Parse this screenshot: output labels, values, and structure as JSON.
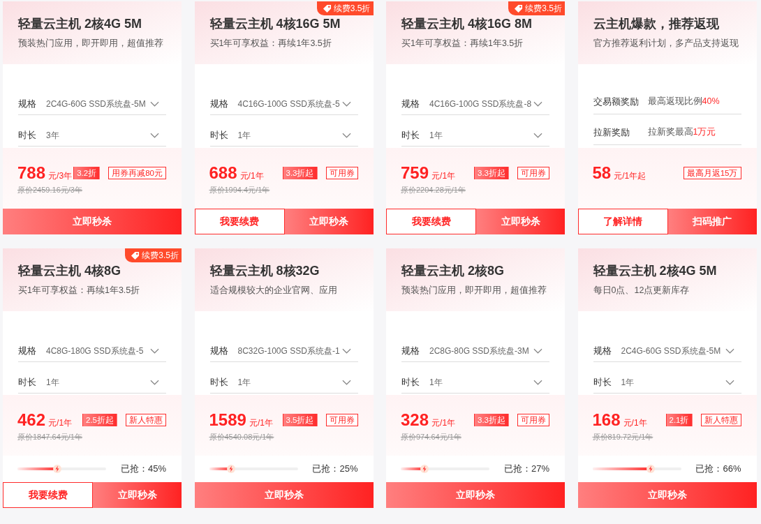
{
  "cards": [
    {
      "title": "轻量云主机 2核4G 5M",
      "subtitle": "预装热门应用，即开即用，超值推荐",
      "fields": [
        {
          "label": "规格",
          "value": "2C4G-60G SSD系统盘-5M"
        },
        {
          "label": "时长",
          "value": "3年"
        }
      ],
      "price": "788",
      "unit": "元/3年",
      "tags": [
        {
          "text": "3.2折",
          "kind": "filled"
        },
        {
          "text": "用券再减80元",
          "kind": "outline"
        }
      ],
      "original": "原价2459.16元/3年",
      "buttons": [
        {
          "label": "立即秒杀",
          "kind": "solid"
        }
      ]
    },
    {
      "title": "轻量云主机 4核16G 5M",
      "subtitle": "买1年可享权益：再续1年3.5折",
      "badge": "续费3.5折",
      "fields": [
        {
          "label": "规格",
          "value": "4C16G-100G SSD系统盘-5"
        },
        {
          "label": "时长",
          "value": "1年"
        }
      ],
      "price": "688",
      "unit": "元/1年",
      "tags": [
        {
          "text": "3.3折起",
          "kind": "filled"
        },
        {
          "text": "可用券",
          "kind": "outline"
        }
      ],
      "original": "原价1994.4元/1年",
      "buttons": [
        {
          "label": "我要续费",
          "kind": "outline"
        },
        {
          "label": "立即秒杀",
          "kind": "solid"
        }
      ]
    },
    {
      "title": "轻量云主机 4核16G 8M",
      "subtitle": "买1年可享权益：再续1年3.5折",
      "badge": "续费3.5折",
      "fields": [
        {
          "label": "规格",
          "value": "4C16G-100G SSD系统盘-8"
        },
        {
          "label": "时长",
          "value": "1年"
        }
      ],
      "price": "759",
      "unit": "元/1年",
      "tags": [
        {
          "text": "3.3折起",
          "kind": "filled"
        },
        {
          "text": "可用券",
          "kind": "outline"
        }
      ],
      "original": "原价2204.28元/1年",
      "buttons": [
        {
          "label": "我要续费",
          "kind": "outline"
        },
        {
          "label": "立即秒杀",
          "kind": "solid"
        }
      ]
    },
    {
      "title": "云主机爆款，推荐返现",
      "subtitle": "官方推荐返利计划，多产品支持返现",
      "rewards": [
        {
          "label": "交易额奖励",
          "value": "最高返现比例",
          "highlight": "40%"
        },
        {
          "label": "拉新奖励",
          "value": "拉新奖最高",
          "highlight": "1万元"
        }
      ],
      "price": "58",
      "unit": "元/1年起",
      "tags": [
        {
          "text": "最高月返15万",
          "kind": "outline"
        }
      ],
      "buttons": [
        {
          "label": "了解详情",
          "kind": "outline"
        },
        {
          "label": "扫码推广",
          "kind": "solid"
        }
      ]
    },
    {
      "title": "轻量云主机 4核8G",
      "subtitle": "买1年可享权益：再续1年3.5折",
      "badge": "续费3.5折",
      "fields": [
        {
          "label": "规格",
          "value": "4C8G-180G SSD系统盘-5"
        },
        {
          "label": "时长",
          "value": "1年"
        }
      ],
      "price": "462",
      "unit": "元/1年",
      "tags": [
        {
          "text": "2.5折起",
          "kind": "filled"
        },
        {
          "text": "新人特惠",
          "kind": "outline"
        }
      ],
      "original": "原价1847.64元/1年",
      "progress": {
        "level": 0.45,
        "reading": "已抢：45%"
      },
      "buttons": [
        {
          "label": "我要续费",
          "kind": "outline"
        },
        {
          "label": "立即秒杀",
          "kind": "solid"
        }
      ]
    },
    {
      "title": "轻量云主机 8核32G",
      "subtitle": "适合规模较大的企业官网、应用",
      "fields": [
        {
          "label": "规格",
          "value": "8C32G-100G SSD系统盘-1"
        },
        {
          "label": "时长",
          "value": "1年"
        }
      ],
      "price": "1589",
      "unit": "元/1年",
      "tags": [
        {
          "text": "3.5折起",
          "kind": "filled"
        },
        {
          "text": "可用券",
          "kind": "outline"
        }
      ],
      "original": "原价4540.08元/1年",
      "progress": {
        "level": 0.25,
        "reading": "已抢：25%"
      },
      "buttons": [
        {
          "label": "立即秒杀",
          "kind": "solid"
        }
      ]
    },
    {
      "title": "轻量云主机 2核8G",
      "subtitle": "预装热门应用，即开即用，超值推荐",
      "fields": [
        {
          "label": "规格",
          "value": "2C8G-80G SSD系统盘-3M"
        },
        {
          "label": "时长",
          "value": "1年"
        }
      ],
      "price": "328",
      "unit": "元/1年",
      "tags": [
        {
          "text": "3.3折起",
          "kind": "filled"
        },
        {
          "text": "可用券",
          "kind": "outline"
        }
      ],
      "original": "原价974.64元/1年",
      "progress": {
        "level": 0.27,
        "reading": "已抢：27%"
      },
      "buttons": [
        {
          "label": "立即秒杀",
          "kind": "solid"
        }
      ]
    },
    {
      "title": "轻量云主机 2核4G 5M",
      "subtitle": "每日0点、12点更新库存",
      "fields": [
        {
          "label": "规格",
          "value": "2C4G-60G SSD系统盘-5M"
        },
        {
          "label": "时长",
          "value": "1年"
        }
      ],
      "price": "168",
      "unit": "元/1年",
      "tags": [
        {
          "text": "2.1折",
          "kind": "filled"
        },
        {
          "text": "新人特惠",
          "kind": "outline"
        }
      ],
      "original": "原价819.72元/1年",
      "progress": {
        "level": 0.66,
        "reading": "已抢：66%"
      },
      "buttons": [
        {
          "label": "立即秒杀",
          "kind": "solid"
        }
      ]
    }
  ]
}
